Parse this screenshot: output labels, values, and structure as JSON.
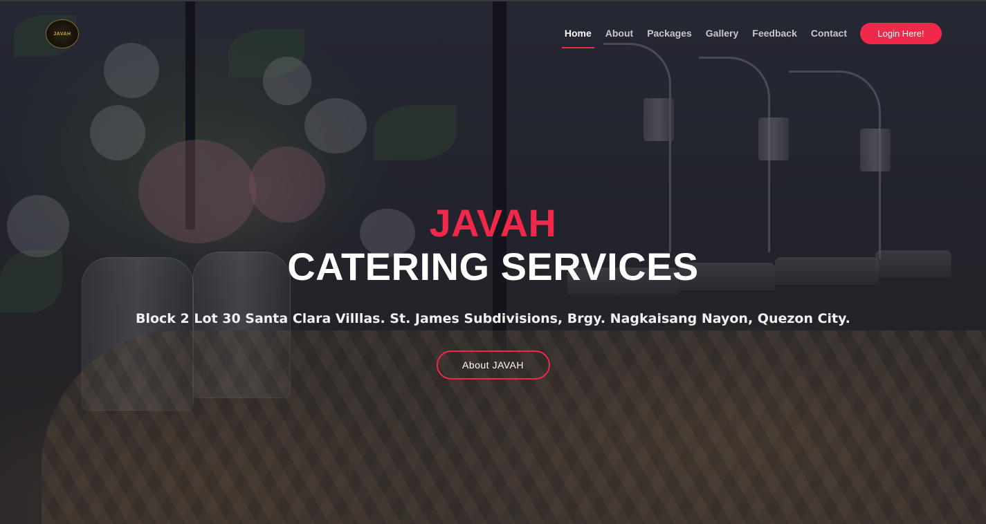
{
  "logo": {
    "text": "JAVAH"
  },
  "nav": {
    "items": [
      {
        "label": "Home"
      },
      {
        "label": "About"
      },
      {
        "label": "Packages"
      },
      {
        "label": "Gallery"
      },
      {
        "label": "Feedback"
      },
      {
        "label": "Contact"
      }
    ],
    "active": "Home",
    "login_label": "Login Here!"
  },
  "hero": {
    "brand": "JAVAH",
    "title": "CATERING SERVICES",
    "address": "Block 2 Lot 30 Santa Clara Villlas. St. James Subdivisions, Brgy. Nagkaisang Nayon, Quezon City.",
    "cta_label": "About JAVAH"
  },
  "colors": {
    "accent": "#f0284a",
    "text": "#ffffff",
    "nav_text": "#c8c8cc"
  }
}
